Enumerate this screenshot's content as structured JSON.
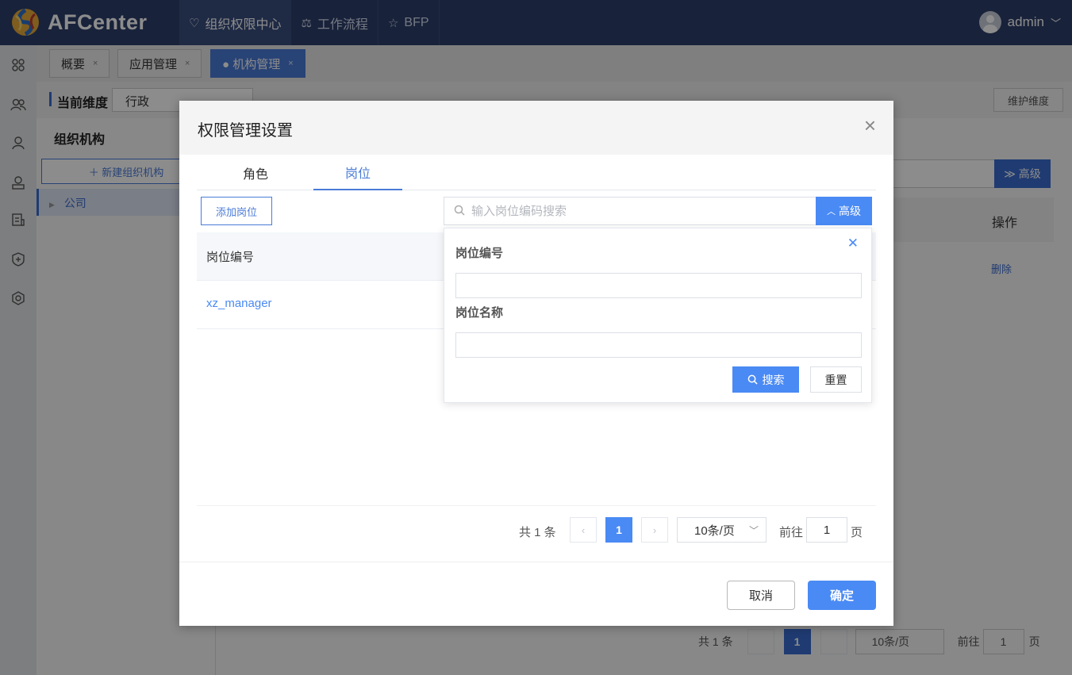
{
  "app": {
    "brand": "AFCenter",
    "user": "admin"
  },
  "nav": [
    {
      "label": "组织权限中心",
      "icon": "shield-heart-icon"
    },
    {
      "label": "工作流程",
      "icon": "scale-icon"
    },
    {
      "label": "BFP",
      "icon": "star-icon"
    }
  ],
  "page_tabs": [
    {
      "label": "概要"
    },
    {
      "label": "应用管理"
    },
    {
      "label": "● 机构管理"
    }
  ],
  "background": {
    "dimension_label": "当前维度",
    "dimension_value": "行政",
    "maintain_button": "维护维度",
    "org_title": "组织机构",
    "new_org_button": "＋ 新建组织机构",
    "tree_item": "公司",
    "advanced_button": "≫ 高级",
    "ops_header": "操作",
    "delete_link": "删除",
    "pagination": {
      "total": "共 1 条",
      "current": "1",
      "size": "10条/页",
      "goto": "前往",
      "goto_value": "1",
      "page": "页"
    }
  },
  "dialog": {
    "title": "权限管理设置",
    "tabs": [
      "角色",
      "岗位"
    ],
    "active_tab": "岗位",
    "add_button": "添加岗位",
    "search_placeholder": "输入岗位编码搜索",
    "advanced_button": "高级",
    "table": {
      "header": "岗位编号",
      "rows": [
        {
          "code": "xz_manager"
        }
      ]
    },
    "pagination": {
      "total": "共 1 条",
      "current": "1",
      "size": "10条/页",
      "goto": "前往",
      "goto_value": "1",
      "page": "页"
    },
    "cancel": "取消",
    "ok": "确定"
  },
  "popover": {
    "field1_label": "岗位编号",
    "field2_label": "岗位名称",
    "search_button": "搜索",
    "reset_button": "重置"
  },
  "colors": {
    "topbar": "#2c3e6b",
    "primary": "#4a8af4",
    "accent": "#3a6ccf"
  }
}
